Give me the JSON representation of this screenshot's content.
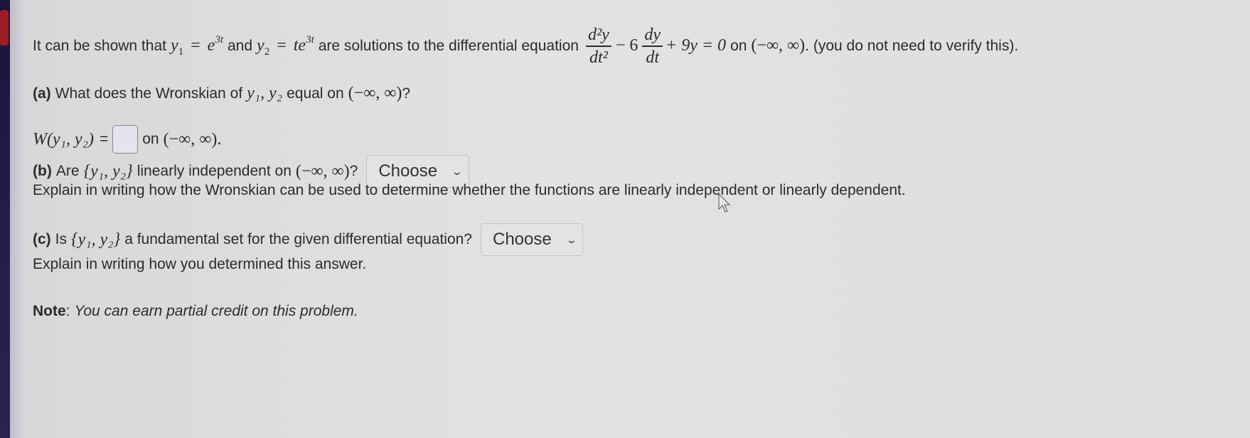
{
  "intro": {
    "prefix": "It can be shown that",
    "y1": "y",
    "y1_sub": "1",
    "eq": "=",
    "y1_val": "e",
    "y1_exp": "3t",
    "and": "and",
    "y2": "y",
    "y2_sub": "2",
    "y2_val": "te",
    "y2_exp": "3t",
    "middle": "are solutions to the differential equation",
    "frac1_num": "d²y",
    "frac1_den": "dt²",
    "minus6": "− 6",
    "frac2_num": "dy",
    "frac2_den": "dt",
    "tail_math": "+ 9y = 0",
    "on": "on",
    "interval": "(−∞, ∞)",
    "suffix": ". (you do not need to verify this)."
  },
  "part_a": {
    "label": "(a)",
    "question": "What does the Wronskian of",
    "vars": "y₁, y₂",
    "question_end": "equal on",
    "interval": "(−∞, ∞)",
    "qmark": "?",
    "w_label": "W(y₁, y₂)",
    "equals": "=",
    "answer_value": "",
    "on": "on",
    "interval2": "(−∞, ∞)."
  },
  "part_b": {
    "label": "(b)",
    "question_start": "Are",
    "set": "{y₁, y₂}",
    "question_mid": "linearly independent on",
    "interval": "(−∞, ∞)",
    "qmark": "?",
    "select_value": "Choose",
    "explain": "Explain in writing how the Wronskian can be used to determine whether the functions are linearly independent or linearly dependent."
  },
  "part_c": {
    "label": "(c)",
    "question_start": "Is",
    "set": "{y₁, y₂}",
    "question_mid": "a fundamental set for the given differential equation?",
    "select_value": "Choose",
    "explain": "Explain in writing how you determined this answer."
  },
  "note": {
    "label": "Note",
    "colon": ":",
    "text": "You can earn partial credit on this problem."
  }
}
